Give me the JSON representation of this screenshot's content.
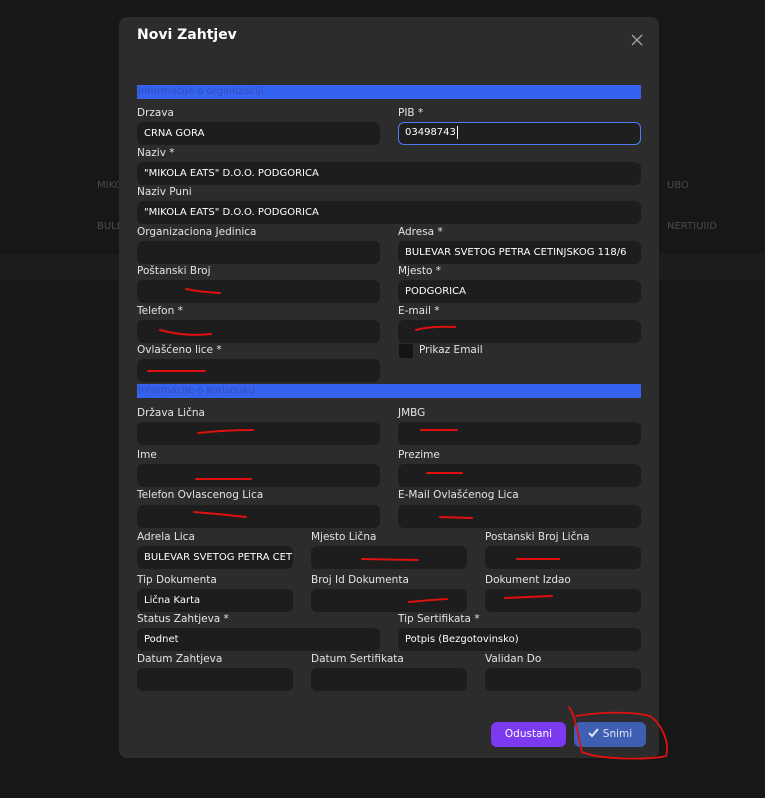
{
  "background": {
    "row1_left": "MIKO",
    "row1_right": "UBO",
    "row2_left": "BULE",
    "row2_right": "NERTIUIID"
  },
  "modal": {
    "title": "Novi Zahtjev",
    "close_icon": "close-icon"
  },
  "sections": {
    "org": "Informacije o organizaciji",
    "user": "Informacije o korisnuku"
  },
  "fields": {
    "drzava": {
      "label": "Drzava",
      "value": "CRNA GORA"
    },
    "pib": {
      "label": "PIB *",
      "value": "03498743"
    },
    "naziv": {
      "label": "Naziv *",
      "value": "\"MIKOLA EATS\" D.O.O. PODGORICA"
    },
    "naziv_puni": {
      "label": "Naziv Puni",
      "value": "\"MIKOLA EATS\" D.O.O. PODGORICA"
    },
    "org_jedinica": {
      "label": "Organizaciona Jedinica",
      "value": ""
    },
    "adresa": {
      "label": "Adresa *",
      "value": "BULEVAR SVETOG PETRA CETINJSKOG 118/6"
    },
    "postanski_broj": {
      "label": "Poštanski Broj",
      "value": ""
    },
    "mjesto": {
      "label": "Mjesto *",
      "value": "PODGORICA"
    },
    "telefon": {
      "label": "Telefon *",
      "value": ""
    },
    "email": {
      "label": "E-mail *",
      "value": ""
    },
    "ovlasceno_lice": {
      "label": "Ovlašćeno lice *",
      "value": ""
    },
    "prikaz_email": {
      "label": "Prikaz Email"
    },
    "drzava_licna": {
      "label": "Država Lična",
      "value": ""
    },
    "jmbg": {
      "label": "JMBG",
      "value": ""
    },
    "ime": {
      "label": "Ime",
      "value": ""
    },
    "prezime": {
      "label": "Prezime",
      "value": ""
    },
    "telefon_ovl": {
      "label": "Telefon Ovlascenog Lica",
      "value": ""
    },
    "email_ovl": {
      "label": "E-Mail Ovlašćenog Lica",
      "value": ""
    },
    "adresa_lica": {
      "label": "Adrela Lica",
      "value": "BULEVAR SVETOG PETRA CETINJSKOG"
    },
    "mjesto_licna": {
      "label": "Mjesto Lična",
      "value": ""
    },
    "postanski_licna": {
      "label": "Postanski Broj Lična",
      "value": ""
    },
    "tip_dokumenta": {
      "label": "Tip Dokumenta",
      "value": "Lična Karta"
    },
    "broj_dokumenta": {
      "label": "Broj Id Dokumenta",
      "value": ""
    },
    "dokument_izdao": {
      "label": "Dokument Izdao",
      "value": ""
    },
    "status_zahtjeva": {
      "label": "Status Zahtjeva *",
      "value": "Podnet"
    },
    "tip_sertifikata": {
      "label": "Tip Sertifikata *",
      "value": "Potpis (Bezgotovinsko)"
    },
    "datum_zahtjeva": {
      "label": "Datum Zahtjeva",
      "value": ""
    },
    "datum_sertifikata": {
      "label": "Datum Sertifikata",
      "value": ""
    },
    "validan_do": {
      "label": "Validan Do",
      "value": ""
    }
  },
  "buttons": {
    "cancel": "Odustani",
    "save": "Snimi",
    "save_icon": "check-icon"
  },
  "colors": {
    "section_bar": "#3563f0",
    "cancel_button": "#7b3af0",
    "save_button": "#3e5fb2",
    "annotation": "#e01010"
  }
}
